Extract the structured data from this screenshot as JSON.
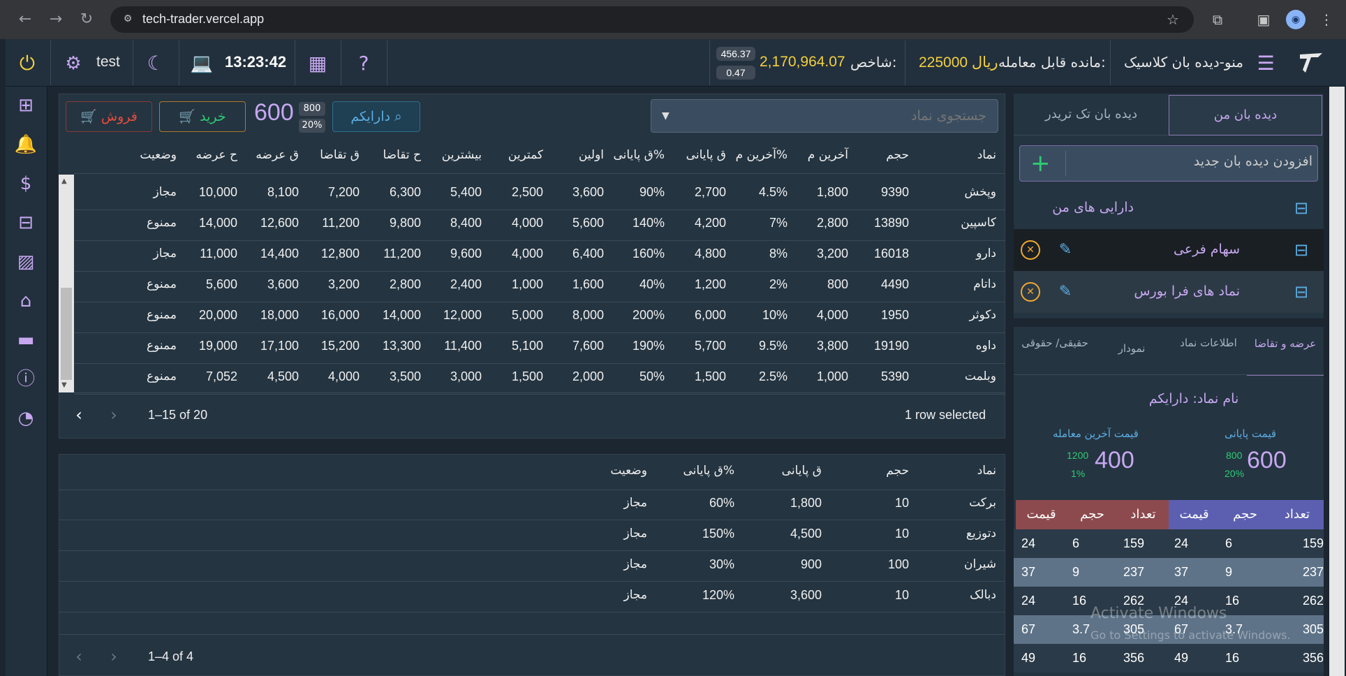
{
  "browser": {
    "url": "tech-trader.vercel.app"
  },
  "topbar": {
    "user": "test",
    "clock": "13:23:42",
    "badge_top": "456.37",
    "badge_bottom": "0.47",
    "index_value": "2,170,964.07",
    "index_label": "شاخص:",
    "balance_value": "225000 ریال",
    "balance_label": "مانده قابل معامله:",
    "menu_title": "منو-دیده بان کلاسیک"
  },
  "toolbar": {
    "sell_label": "فروش",
    "buy_label": "خرید",
    "price": "600",
    "badge_top": "800",
    "badge_bottom": "20%",
    "symbol": "دارایکم",
    "search_placeholder": "جستجوی نماد"
  },
  "main_table": {
    "columns": [
      "نماد",
      "حجم",
      "آخرین م",
      "آخرین م%",
      "ق پایانی",
      "ق پایانی%",
      "اولین",
      "کمترین",
      "بیشترین",
      "ح تقاضا",
      "ق تقاضا",
      "ق عرضه",
      "ح عرضه",
      "وضعیت"
    ],
    "rows": [
      [
        "وپخش",
        "9390",
        "1,800",
        "4.5%",
        "2,700",
        "90%",
        "3,600",
        "2,500",
        "5,400",
        "6,300",
        "7,200",
        "8,100",
        "10,000",
        "مجاز"
      ],
      [
        "کاسپین",
        "13890",
        "2,800",
        "7%",
        "4,200",
        "140%",
        "5,600",
        "4,000",
        "8,400",
        "9,800",
        "11,200",
        "12,600",
        "14,000",
        "ممنوع"
      ],
      [
        "دارو",
        "16018",
        "3,200",
        "8%",
        "4,800",
        "160%",
        "6,400",
        "4,000",
        "9,600",
        "11,200",
        "12,800",
        "14,400",
        "11,000",
        "مجاز"
      ],
      [
        "داتام",
        "4490",
        "800",
        "2%",
        "1,200",
        "40%",
        "1,600",
        "1,000",
        "2,400",
        "2,800",
        "3,200",
        "3,600",
        "5,600",
        "ممنوع"
      ],
      [
        "دکوثر",
        "1950",
        "4,000",
        "10%",
        "6,000",
        "200%",
        "8,000",
        "5,000",
        "12,000",
        "14,000",
        "16,000",
        "18,000",
        "20,000",
        "ممنوع"
      ],
      [
        "داوه",
        "19190",
        "3,800",
        "9.5%",
        "5,700",
        "190%",
        "7,600",
        "5,100",
        "11,400",
        "13,300",
        "15,200",
        "17,100",
        "19,000",
        "ممنوع"
      ],
      [
        "وبلمت",
        "5390",
        "1,000",
        "2.5%",
        "1,500",
        "50%",
        "2,000",
        "1,500",
        "3,000",
        "3,500",
        "4,000",
        "4,500",
        "7,052",
        "ممنوع"
      ]
    ],
    "selected_text": "1 row selected",
    "pager_text": "1–15 of 20"
  },
  "bottom_table": {
    "columns": [
      "نماد",
      "حجم",
      "ق پایانی",
      "ق پایانی%",
      "وضعیت"
    ],
    "rows": [
      [
        "برکت",
        "10",
        "1,800",
        "60%",
        "مجاز"
      ],
      [
        "دتوزیع",
        "10",
        "4,500",
        "150%",
        "مجاز"
      ],
      [
        "شیران",
        "100",
        "900",
        "30%",
        "مجاز"
      ],
      [
        "دبالک",
        "10",
        "3,600",
        "120%",
        "مجاز"
      ]
    ],
    "pager_text": "1–4 of 4"
  },
  "watchlists": {
    "tab_mine": "دیده بان من",
    "tab_trader": "دیده بان تک تریدر",
    "add_placeholder": "افزودن دیده بان جدید",
    "items": [
      "دارایی های من",
      "سهام فرعی",
      "نماد های فرا بورس"
    ]
  },
  "info": {
    "tabs": [
      "عرضه و تقاضا",
      "اطلاعات نماد",
      "نمودار",
      "حقیقی/ حقوقی"
    ],
    "symbol_name": "نام نماد: دارایکم",
    "final_label": "قیمت پایانی",
    "final_price": "600",
    "final_a": "800",
    "final_b": "20%",
    "last_label": "قیمت آخرین معامله",
    "last_price": "400",
    "last_a": "1200",
    "last_b": "1%"
  },
  "orderbook": {
    "headers": [
      "تعداد",
      "حجم",
      "قیمت",
      "تعداد",
      "حجم",
      "قیمت"
    ],
    "rows": [
      [
        "159",
        "6",
        "24",
        "159",
        "6",
        "24"
      ],
      [
        "237",
        "9",
        "37",
        "237",
        "9",
        "37"
      ],
      [
        "262",
        "16",
        "24",
        "262",
        "16",
        "24"
      ],
      [
        "305",
        "3.7",
        "67",
        "305",
        "3.7",
        "67"
      ],
      [
        "356",
        "16",
        "49",
        "356",
        "16",
        "49"
      ]
    ],
    "buy_color": "#5c5fb0",
    "sell_color": "#8c4a4e"
  },
  "watermark": {
    "line1": "Activate Windows",
    "line2": "Go to Settings to activate Windows."
  }
}
